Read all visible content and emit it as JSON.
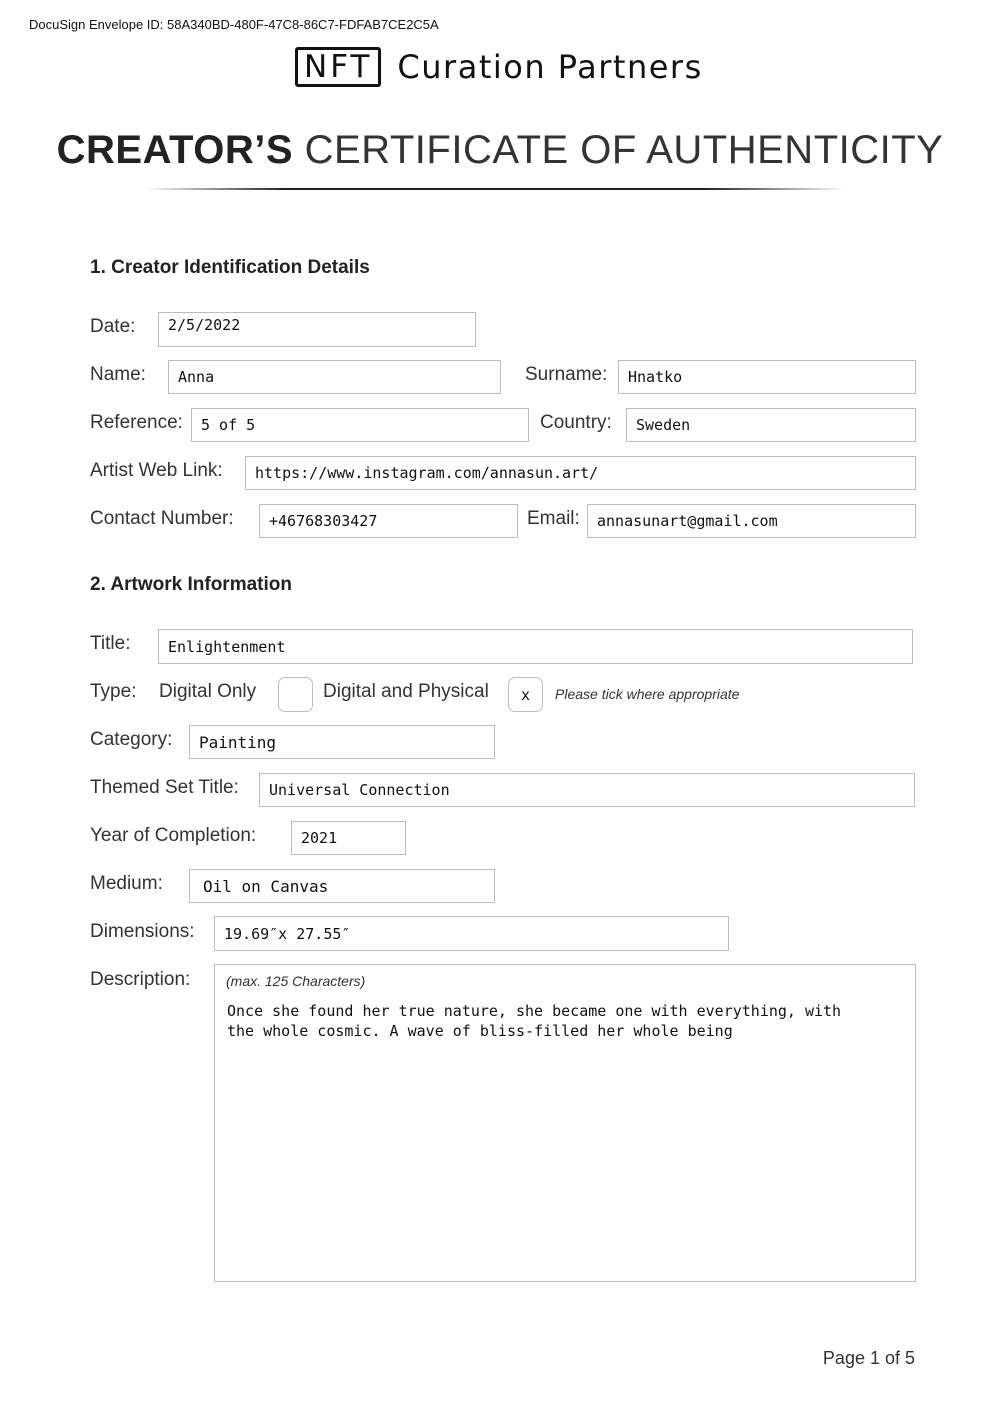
{
  "envelope_id": "DocuSign Envelope ID: 58A340BD-480F-47C8-86C7-FDFAB7CE2C5A",
  "logo": {
    "mark": "NFT",
    "text": "Curation Partners"
  },
  "certificate": {
    "title_bold": "CREATOR’S",
    "title_rest": "CERTIFICATE OF AUTHENTICITY"
  },
  "section1": {
    "heading": "1. Creator Identification Details",
    "date": {
      "label": "Date:",
      "value": "2/5/2022"
    },
    "name": {
      "label": "Name:",
      "value": "Anna"
    },
    "surname": {
      "label": "Surname:",
      "value": "Hnatko"
    },
    "reference": {
      "label": "Reference:",
      "value": "5 of 5"
    },
    "country": {
      "label": "Country:",
      "value": "Sweden"
    },
    "web_link": {
      "label": "Artist Web Link:",
      "value": "https://www.instagram.com/annasun.art/"
    },
    "contact": {
      "label": "Contact Number:",
      "value": "+46768303427"
    },
    "email": {
      "label": "Email:",
      "value": "annasunart@gmail.com"
    }
  },
  "section2": {
    "heading": "2. Artwork Information",
    "title": {
      "label": "Title:",
      "value": "Enlightenment"
    },
    "type": {
      "label": "Type:",
      "options": [
        {
          "label": "Digital Only",
          "mark": ""
        },
        {
          "label": "Digital and Physical",
          "mark": "x"
        }
      ],
      "hint": "Please tick where appropriate"
    },
    "category": {
      "label": "Category:",
      "value": "Painting"
    },
    "themed_set": {
      "label": "Themed Set Title:",
      "value": "Universal Connection"
    },
    "year": {
      "label": "Year of Completion:",
      "value": "2021"
    },
    "medium": {
      "label": "Medium:",
      "value": "Oil on Canvas"
    },
    "dimensions": {
      "label": "Dimensions:",
      "value": "19.69″x 27.55″"
    },
    "description": {
      "label": "Description:",
      "hint": "(max. 125 Characters)",
      "value": "Once she found her true nature, she became one with everything, with the whole cosmic. A wave of bliss-filled her whole being"
    }
  },
  "footer": {
    "page": "Page 1 of 5"
  }
}
